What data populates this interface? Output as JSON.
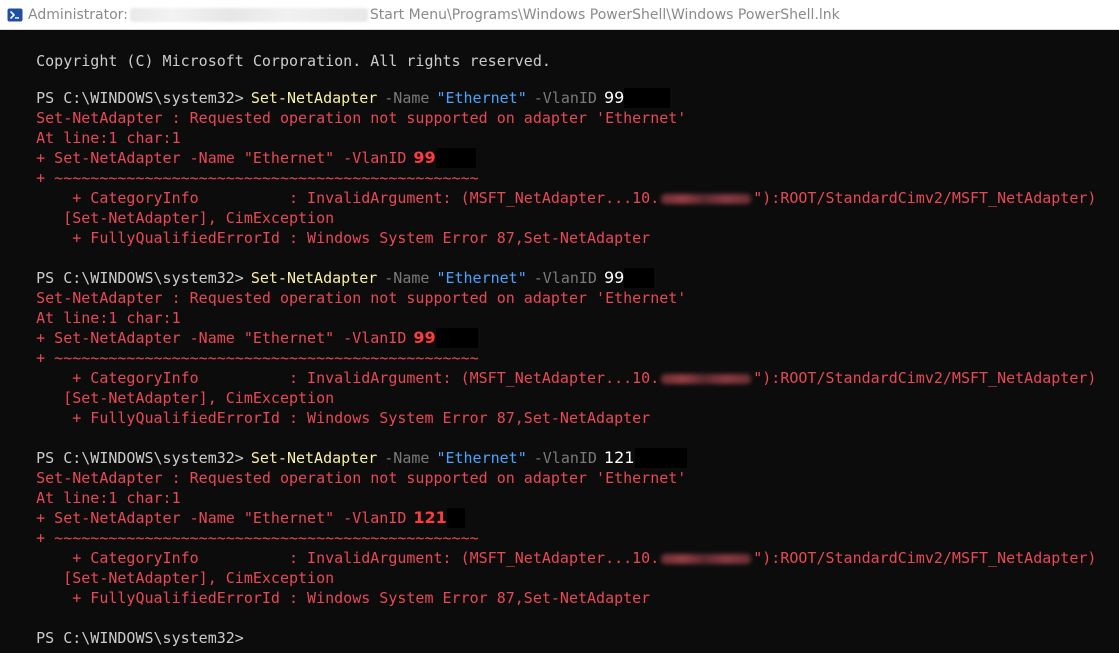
{
  "window": {
    "title_prefix": "Administrator:",
    "title_suffix": "Start Menu\\Programs\\Windows PowerShell\\Windows PowerShell.lnk"
  },
  "terminal": {
    "copyright": "Copyright (C) Microsoft Corporation. All rights reserved.",
    "prompt": "PS C:\\WINDOWS\\system32>",
    "command": {
      "cmdlet": "Set-NetAdapter",
      "name_param": "-Name",
      "adapter_name": "\"Ethernet\"",
      "vlan_param": "-VlanID"
    },
    "messages": {
      "error": "Set-NetAdapter : Requested operation not supported on adapter 'Ethernet'",
      "location": "At line:1 char:1",
      "echo": "+ Set-NetAdapter -Name \"Ethernet\" -VlanID",
      "underline": "+ ~~~~~~~~~~~~~~~~~~~~~~~~~~~~~~~~~~~~~~~~~~~~~~~",
      "category_prefix": "    + CategoryInfo          : InvalidArgument: (MSFT_NetAdapter...10.",
      "category_suffix": "\"):ROOT/StandardCimv2/MSFT_NetAdapter)",
      "exception": "   [Set-NetAdapter], CimException",
      "fqid": "    + FullyQualifiedErrorId : Windows System Error 87,Set-NetAdapter"
    },
    "vlan_values": [
      "99",
      "99",
      "121"
    ]
  }
}
